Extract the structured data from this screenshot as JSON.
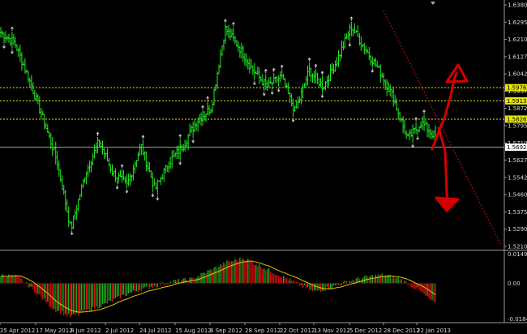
{
  "colors": {
    "background": "#000000",
    "bar_up": "#22ee22",
    "bar_down": "#22ee22",
    "hist_pos": "#1fae1f",
    "hist_neg": "#e01010",
    "signal": "#e6c200",
    "level_dotted": "#e6e600",
    "level_solid": "#9a9a9a",
    "trendline": "#cc1010",
    "annotation": "#d40000",
    "fractal": "#dddddd"
  },
  "price_axis": {
    "labels": [
      "1.63800",
      "1.62950",
      "1.62100",
      "1.61275",
      "1.60425",
      "1.59575",
      "1.58725",
      "1.57950",
      "1.57100",
      "1.56275",
      "1.55425",
      "1.54600",
      "1.53750",
      "1.52900",
      "1.52100"
    ],
    "highlighted": [
      {
        "value": "1.59764",
        "price": 1.59764,
        "bg": "#e6e600",
        "style": "dotted"
      },
      {
        "value": "1.59135",
        "price": 1.59135,
        "bg": "#e6e600",
        "style": "dotted"
      },
      {
        "value": "1.58262",
        "price": 1.58262,
        "bg": "#e6e600",
        "style": "dotted"
      },
      {
        "value": "1.56922",
        "price": 1.56922,
        "bg": "#ffffff",
        "style": "solid"
      }
    ]
  },
  "osc_axis": {
    "labels": [
      "0.0149",
      "0.00",
      "-0.0184"
    ]
  },
  "time_axis": {
    "labels": [
      "25 Apr 2012",
      "17 May 2012",
      "8 Jun 2012",
      "2 Jul 2012",
      "24 Jul 2012",
      "15 Aug 2012",
      "6 Sep 2012",
      "28 Sep 2012",
      "22 Oct 2012",
      "13 Nov 2012",
      "5 Dec 2012",
      "28 Dec 2012",
      "22 Jan 2013"
    ]
  },
  "chart_data": {
    "type": "line",
    "symbol_note": "",
    "price_range": [
      1.521,
      1.638
    ],
    "anchor_prices": [
      1.624,
      1.619,
      1.602,
      1.583,
      1.563,
      1.53,
      1.556,
      1.572,
      1.557,
      1.551,
      1.57,
      1.549,
      1.562,
      1.57,
      1.582,
      1.588,
      1.626,
      1.617,
      1.606,
      1.598,
      1.603,
      1.586,
      1.606,
      1.598,
      1.611,
      1.627,
      1.616,
      1.606,
      1.593,
      1.573,
      1.581,
      1.574
    ],
    "oscillator_range": [
      -0.0184,
      0.0149
    ],
    "oscillator_anchors": [
      0.004,
      0.003,
      -0.004,
      -0.012,
      -0.016,
      -0.013,
      -0.01,
      -0.006,
      -0.003,
      -0.001,
      0.001,
      0.002,
      0.006,
      0.01,
      0.012,
      0.008,
      0.004,
      0.0,
      -0.004,
      -0.002,
      0.001,
      0.003,
      0.004,
      0.002,
      -0.003,
      -0.01
    ]
  }
}
